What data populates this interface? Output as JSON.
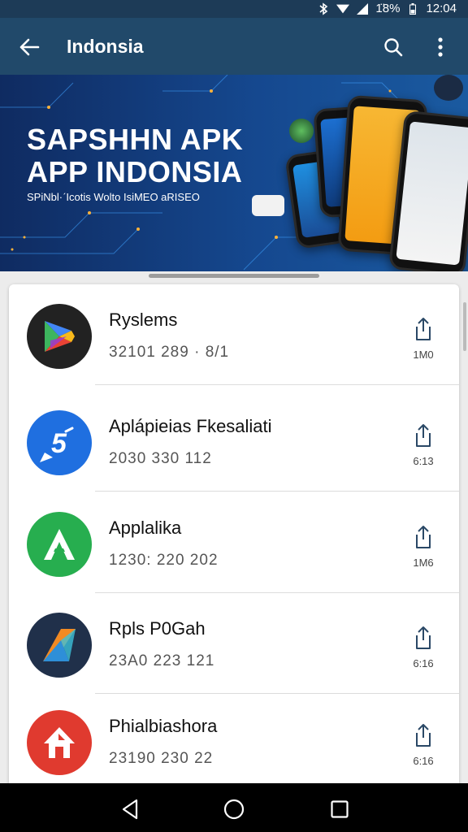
{
  "status_bar": {
    "battery": "1̈8%",
    "time": "12:04",
    "icons": [
      "bluetooth-icon",
      "wifi-icon",
      "signal-icon",
      "battery-icon"
    ]
  },
  "app_bar": {
    "title": "Indonsia",
    "icons": [
      "back-arrow-icon",
      "search-icon",
      "more-vert-icon"
    ]
  },
  "banner": {
    "title_line1": "SAPSHHN APK",
    "title_line2": "APP INDONSIA",
    "subtitle": "SPiNbl·ˊIcotis Wolto IsiMEO aRISEO"
  },
  "apps": [
    {
      "name": "Ryslems",
      "meta": "32101 289 · 8/1",
      "size": "1M0",
      "icon": "play-store-icon",
      "color": "#222222"
    },
    {
      "name": "Aplápieias Fkesaliati",
      "meta": "2030 330 112",
      "size": "6:13",
      "icon": "chat-bubble-icon",
      "color": "#1f6fe0"
    },
    {
      "name": "Applalika",
      "meta": "1230: 220 202",
      "size": "1M6",
      "icon": "letter-a-icon",
      "color": "#27ae4f"
    },
    {
      "name": "Rpls P0Gah",
      "meta": "23A0 223 121",
      "size": "6:16",
      "icon": "arrow-logo-icon",
      "color": "#20304a"
    },
    {
      "name": "Phialbiashora",
      "meta": "23190 230 22",
      "size": "6:16",
      "icon": "house-logo-icon",
      "color": "#e03a2f"
    }
  ],
  "nav_bar": {
    "icons": [
      "back-triangle-icon",
      "home-circle-icon",
      "recents-square-icon"
    ]
  },
  "colors": {
    "status_bar": "#1d3b57",
    "app_bar": "#21496a",
    "banner": "#15488f",
    "card_bg": "#ffffff",
    "page_bg": "#ececec"
  }
}
